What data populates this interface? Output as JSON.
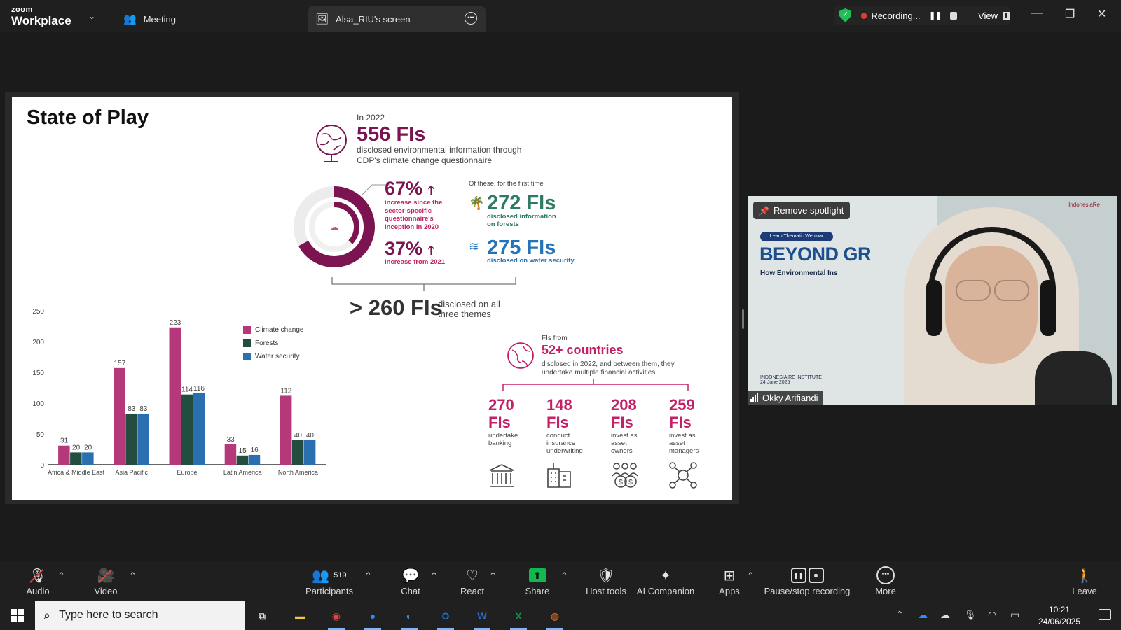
{
  "app": {
    "logo_top": "zoom",
    "logo_bottom": "Workplace"
  },
  "tabs": [
    {
      "label": "Meeting"
    },
    {
      "label": "Alsa_RIU's screen"
    }
  ],
  "recording": {
    "label": "Recording...",
    "view_label": "View"
  },
  "slide": {
    "title": "State of Play",
    "year_label": "In 2022",
    "headline": "556 FIs",
    "headline_desc_1": "disclosed environmental information through",
    "headline_desc_2": "CDP's climate change questionnaire",
    "stat_67": "67%",
    "stat_67_desc": [
      "increase since the",
      "sector-specific",
      "questionnaire's",
      "inception in 2020"
    ],
    "stat_37": "37%",
    "stat_37_desc": "increase from 2021",
    "first_time_label": "Of these, for the first time",
    "forests_value": "272 FIs",
    "forests_desc_1": "disclosed information",
    "forests_desc_2": "on forests",
    "water_value": "275 FIs",
    "water_desc": "disclosed on water security",
    "all_three_value": "> 260 FIs",
    "all_three_desc_1": "disclosed on all",
    "all_three_desc_2": "three themes",
    "countries_label": "FIs from",
    "countries_value": "52+ countries",
    "countries_desc_1": "disclosed in 2022, and between them, they",
    "countries_desc_2": "undertake multiple financial activities.",
    "activities": [
      {
        "value_1": "270",
        "value_2": "FIs",
        "desc": [
          "undertake",
          "banking"
        ],
        "icon": "bank-icon"
      },
      {
        "value_1": "148",
        "value_2": "FIs",
        "desc": [
          "conduct",
          "insurance",
          "underwriting"
        ],
        "icon": "building-icon"
      },
      {
        "value_1": "208",
        "value_2": "FIs",
        "desc": [
          "invest as",
          "asset",
          "owners"
        ],
        "icon": "money-people-icon"
      },
      {
        "value_1": "259",
        "value_2": "FIs",
        "desc": [
          "invest as",
          "asset",
          "managers"
        ],
        "icon": "network-icon"
      }
    ]
  },
  "chart_data": {
    "type": "bar",
    "categories": [
      "Africa & Middle East",
      "Asia Pacific",
      "Europe",
      "Latin America",
      "North America"
    ],
    "series": [
      {
        "name": "Climate change",
        "values": [
          31,
          157,
          223,
          33,
          112
        ],
        "color": "#b5387a"
      },
      {
        "name": "Forests",
        "values": [
          20,
          83,
          114,
          15,
          40
        ],
        "color": "#234e3f"
      },
      {
        "name": "Water security",
        "values": [
          20,
          83,
          116,
          16,
          40
        ],
        "color": "#2a6fb0"
      }
    ],
    "yticks": [
      0,
      50,
      100,
      150,
      200,
      250
    ],
    "ylim": [
      0,
      250
    ],
    "legend": "top-right",
    "grid": false
  },
  "video": {
    "spotlight_label": "Remove spotlight",
    "participant_name": "Okky Arifiandi",
    "sign_pill": "Learn Thematic Webinar",
    "sign_title": "BEYOND GR",
    "sign_subtitle": "How Environmental Ins",
    "sign_institute": "INDONESIA RE INSTITUTE",
    "sign_date": "24 June 2025",
    "sign_logo": "IndonesiaRe"
  },
  "toolbar": {
    "audio": "Audio",
    "video": "Video",
    "participants": "Participants",
    "participants_count": "519",
    "chat": "Chat",
    "react": "React",
    "share": "Share",
    "host_tools": "Host tools",
    "ai_companion": "AI Companion",
    "apps": "Apps",
    "pause_stop": "Pause/stop recording",
    "more": "More",
    "leave": "Leave"
  },
  "taskbar": {
    "search_placeholder": "Type here to search",
    "time": "10:21",
    "date": "24/06/2025"
  }
}
